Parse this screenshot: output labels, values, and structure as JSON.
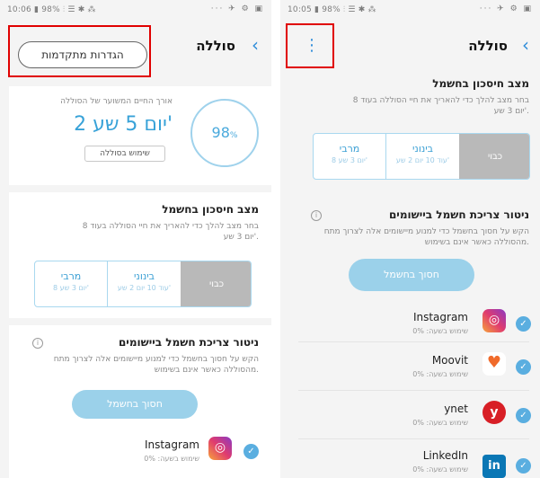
{
  "left": {
    "status": {
      "time": "10:06",
      "battery": "98%",
      "right_icons": "··· ✈ ⚙ ▣"
    },
    "header": {
      "title": "סוללה",
      "back": "‹",
      "advanced_button": "הגדרות מתקדמות"
    },
    "battery_card": {
      "estimated_label": "אורך החיים המשוער של הסוללה",
      "time_left": "2 יום 5 שע'",
      "percent": "98",
      "percent_sign": "%",
      "usage_button": "שימוש בסוללה"
    },
    "power_saving": {
      "title": "מצב חיסכון בחשמל",
      "description": "בחר מצב להלך כדי להאריך את חיי הסוללה בעוד 8 יום 3 שע'.",
      "options": [
        {
          "name": "כבוי",
          "sub": "",
          "selected": true
        },
        {
          "name": "בינוני",
          "sub": "עוד 10 יום 2 שע'",
          "selected": false
        },
        {
          "name": "מרבי",
          "sub": "8 יום 3 שע'",
          "selected": false
        }
      ]
    },
    "app_monitor": {
      "title": "ניטור צריכת חשמל ביישומים",
      "description": "הקש על חסוך בחשמל כדי למנוע מיישומים אלה לצרוך מתח מהסוללה כאשר אינם בשימוש.",
      "info": "i",
      "save_button": "חסוך בחשמל"
    },
    "apps": [
      {
        "name": "Instagram",
        "usage": "שימוש בשעה: 0%"
      }
    ]
  },
  "right": {
    "status": {
      "time": "10:05",
      "battery": "98%",
      "right_icons": "··· ✈ ⚙ ▣"
    },
    "header": {
      "title": "סוללה",
      "back": "‹",
      "menu": "⋮"
    },
    "power_saving": {
      "title": "מצב חיסכון בחשמל",
      "description": "בחר מצב להלך כדי להאריך את חיי הסוללה בעוד 8 יום 3 שע'.",
      "options": [
        {
          "name": "כבוי",
          "sub": "",
          "selected": true
        },
        {
          "name": "בינוני",
          "sub": "עוד 10 יום 2 שע'",
          "selected": false
        },
        {
          "name": "מרבי",
          "sub": "8 יום 3 שע'",
          "selected": false
        }
      ]
    },
    "app_monitor": {
      "title": "ניטור צריכת חשמל ביישומים",
      "description": "הקש על חסוך בחשמל כדי למנוע מיישומים אלה לצרוך מתח מהסוללה כאשר אינם בשימוש.",
      "info": "i",
      "save_button": "חסוך בחשמל"
    },
    "apps": [
      {
        "name": "Instagram",
        "usage": "שימוש בשעה: 0%",
        "icon": "instagram-icon"
      },
      {
        "name": "Moovit",
        "usage": "שימוש בשעה: 0%",
        "icon": "moovit-icon"
      },
      {
        "name": "ynet",
        "usage": "שימוש בשעה: 0%",
        "icon": "ynet-icon"
      },
      {
        "name": "LinkedIn",
        "usage": "שימוש בשעה: 0%",
        "icon": "linkedin-icon"
      }
    ],
    "check_glyph": "✓"
  },
  "colors": {
    "accent": "#2e8cd9",
    "gauge": "#49a9dc",
    "highlight": "#e00000",
    "save_button": "#9bd1ea"
  }
}
